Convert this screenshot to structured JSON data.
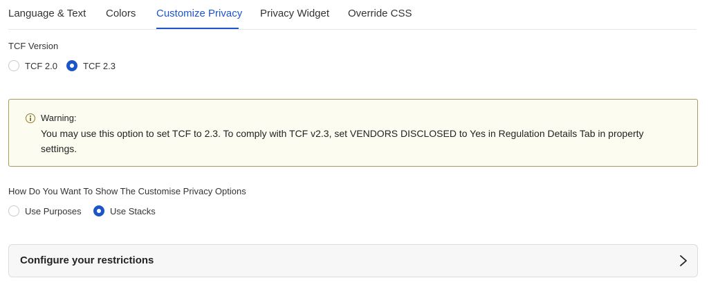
{
  "tabs": [
    {
      "label": "Language & Text",
      "active": false
    },
    {
      "label": "Colors",
      "active": false
    },
    {
      "label": "Customize Privacy",
      "active": true
    },
    {
      "label": "Privacy Widget",
      "active": false
    },
    {
      "label": "Override CSS",
      "active": false
    }
  ],
  "tcf": {
    "label": "TCF Version",
    "options": [
      {
        "label": "TCF 2.0",
        "selected": false
      },
      {
        "label": "TCF 2.3",
        "selected": true
      }
    ]
  },
  "warning": {
    "icon": "info-icon",
    "title": "Warning:",
    "text": "You may use this option to set TCF to 2.3. To comply with TCF v2.3, set VENDORS DISCLOSED to Yes in Regulation Details Tab in property settings."
  },
  "display": {
    "label": "How Do You Want To Show The Customise Privacy Options",
    "options": [
      {
        "label": "Use Purposes",
        "selected": false
      },
      {
        "label": "Use Stacks",
        "selected": true
      }
    ]
  },
  "restrictions": {
    "title": "Configure your restrictions",
    "icon": "chevron-right-icon"
  },
  "colors": {
    "accent": "#1b55c9",
    "warning_bg": "#fdfcf1",
    "warning_border": "#a89a5f"
  }
}
